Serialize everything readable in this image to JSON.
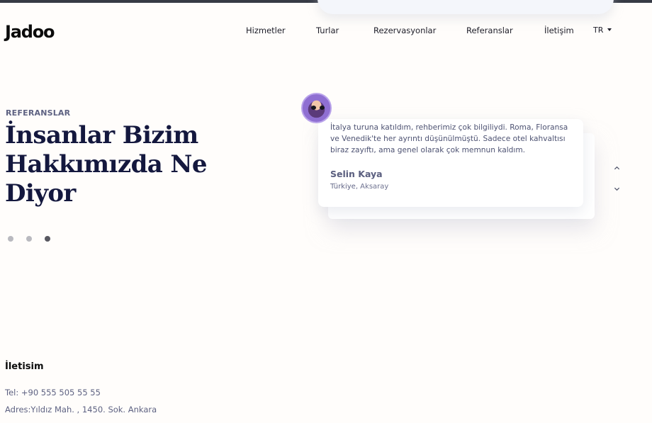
{
  "brand": {
    "logo": "Jadoo"
  },
  "nav": {
    "items": [
      "Hizmetler",
      "Turlar",
      "Rezervasyonlar",
      "Referanslar",
      "İletişim"
    ],
    "language": "TR"
  },
  "testimonials": {
    "section_label": "REFERANSLAR",
    "heading": "İnsanlar Bizim Hakkımızda Ne Diyor",
    "active_slide": 3,
    "slide_count": 3,
    "current": {
      "text": "İtalya turuna katıldım, rehberimiz çok bilgiliydi. Roma, Floransa ve Venedik'te her ayrıntı düşünülmüştü. Sadece otel kahvaltısı biraz zayıftı, ama genel olarak çok memnun kaldım.",
      "name": "Selin Kaya",
      "location": "Türkiye, Aksaray"
    },
    "fading": {
      "name": "Selin Kaya",
      "location": "Türkiye"
    }
  },
  "contact": {
    "title": "İletisim",
    "phone": "Tel: +90 555 505 55 55",
    "address": "Adres:Yıldız Mah. , 1450. Sok. Ankara"
  },
  "colors": {
    "heading": "#14183e",
    "muted": "#5e6282",
    "accent": "#585860"
  }
}
